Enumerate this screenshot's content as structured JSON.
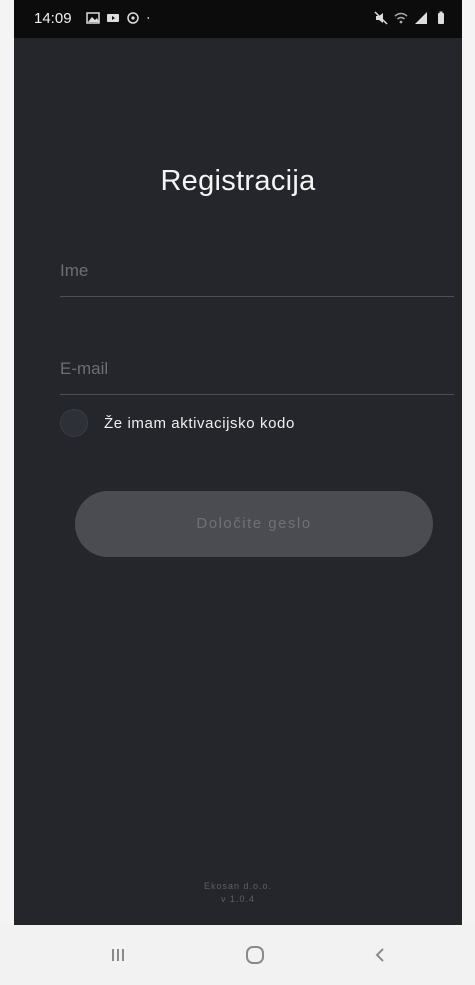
{
  "status_bar": {
    "time": "14:09",
    "left_icons": [
      "gallery-icon",
      "video-icon",
      "vpn-icon",
      "dot-icon"
    ],
    "right_icons": [
      "mute-icon",
      "wifi-icon",
      "signal-icon",
      "battery-icon"
    ]
  },
  "form": {
    "title": "Registracija",
    "name_placeholder": "Ime",
    "email_placeholder": "E-mail",
    "activation_label": "Že imam aktivacijsko kodo",
    "submit_label": "Določite geslo"
  },
  "footer": {
    "company": "Ekosan d.o.o.",
    "version": "v 1.0.4"
  },
  "colors": {
    "background": "#24262b",
    "button_disabled": "#4a4c51",
    "text": "#f4f4f4"
  }
}
